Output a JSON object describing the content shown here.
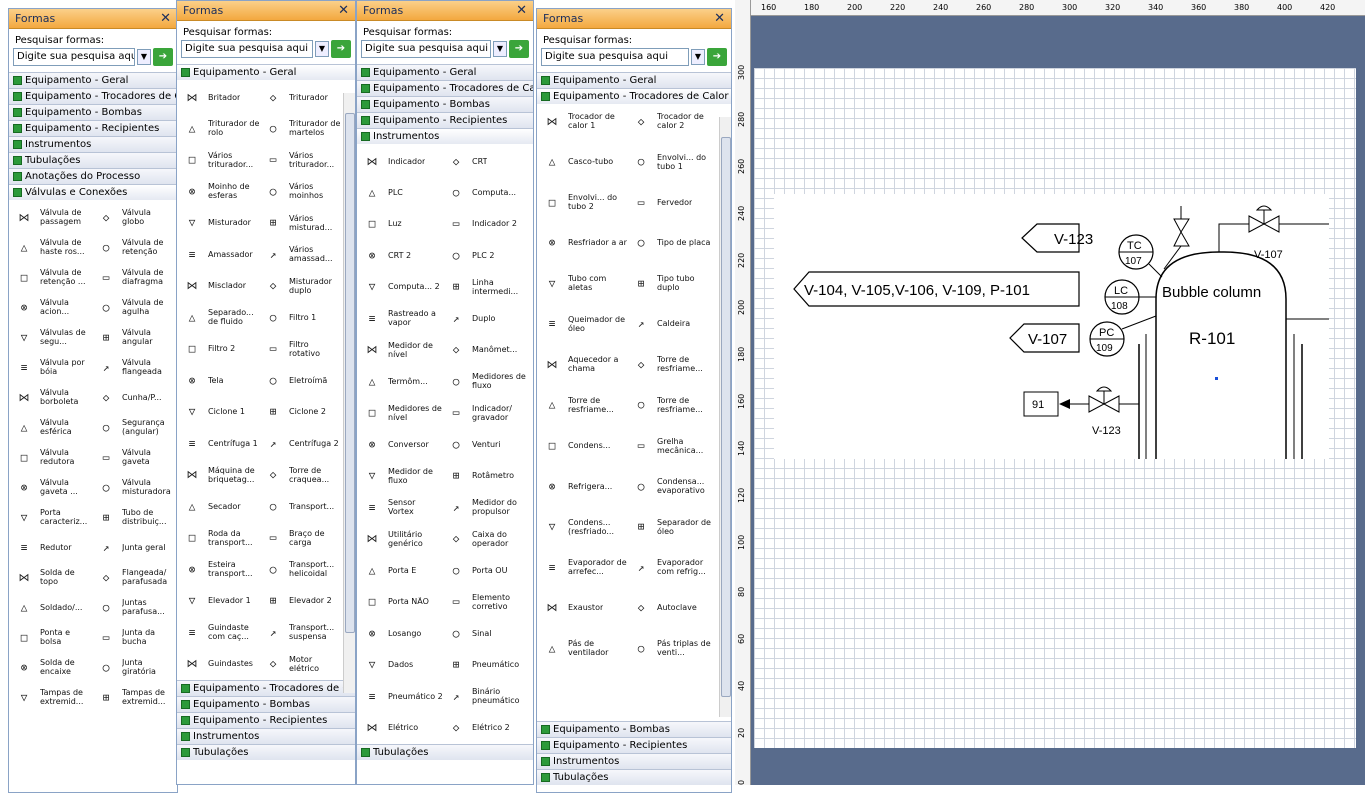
{
  "panel1": {
    "title": "Formas",
    "search_label": "Pesquisar formas:",
    "search_placeholder": "Digite sua pesquisa aqui",
    "categories_top": [
      "Equipamento - Geral",
      "Equipamento - Trocadores de Calor",
      "Equipamento - Bombas",
      "Equipamento - Recipientes",
      "Instrumentos",
      "Tubulações",
      "Anotações do Processo",
      "Válvulas e Conexões"
    ],
    "shapes": [
      "Válvula de passagem",
      "Válvula globo",
      "Válvula de haste ros...",
      "Válvula de retenção",
      "Válvula de retenção ...",
      "Válvula de diafragma",
      "Válvula acion...",
      "Válvula de agulha",
      "Válvulas de segu...",
      "Válvula angular",
      "Válvula por bóia",
      "Válvula flangeada",
      "Válvula borboleta",
      "Cunha/P...",
      "Válvula esférica",
      "Segurança (angular)",
      "Válvula redutora",
      "Válvula gaveta",
      "Válvula gaveta ...",
      "Válvula misturadora",
      "Porta caracteriz...",
      "Tubo de distribuiç...",
      "Redutor",
      "Junta geral",
      "Solda de topo",
      "Flangeada/ parafusada",
      "Soldado/...",
      "Juntas parafusa...",
      "Ponta e bolsa",
      "Junta da bucha",
      "Solda de encaixe",
      "Junta giratória",
      "Tampas de extremid...",
      "Tampas de extremid..."
    ]
  },
  "panel2": {
    "title": "Formas",
    "search_label": "Pesquisar formas:",
    "search_placeholder": "Digite sua pesquisa aqui",
    "categories_top": [
      "Equipamento - Geral"
    ],
    "shapes": [
      "Britador",
      "Triturador",
      "Triturador de rolo",
      "Triturador de martelos",
      "Vários triturador...",
      "Vários triturador...",
      "Moinho de esferas",
      "Vários moinhos",
      "Misturador",
      "Vários misturad...",
      "Amassador",
      "Vários amassad...",
      "Misclador",
      "Misturador duplo",
      "Separado... de fluido",
      "Filtro 1",
      "Filtro 2",
      "Filtro rotativo",
      "Tela",
      "Eletroímã",
      "Ciclone 1",
      "Ciclone 2",
      "Centrífuga 1",
      "Centrífuga 2",
      "Máquina de briquetag...",
      "Torre de craquea...",
      "Secador",
      "Transport...",
      "Roda da transport...",
      "Braço de carga",
      "Esteira transport...",
      "Transport... helicoidal",
      "Elevador 1",
      "Elevador 2",
      "Guindaste com caç...",
      "Transport... suspensa",
      "Guindastes",
      "Motor elétrico"
    ],
    "categories_bottom": [
      "Equipamento - Trocadores de Calor",
      "Equipamento - Bombas",
      "Equipamento - Recipientes",
      "Instrumentos",
      "Tubulações"
    ]
  },
  "panel3": {
    "title": "Formas",
    "search_label": "Pesquisar formas:",
    "search_placeholder": "Digite sua pesquisa aqui",
    "categories_top": [
      "Equipamento - Geral",
      "Equipamento - Trocadores de Calor",
      "Equipamento - Bombas",
      "Equipamento - Recipientes",
      "Instrumentos"
    ],
    "shapes": [
      "Indicador",
      "CRT",
      "PLC",
      "Computa...",
      "Luz",
      "Indicador 2",
      "CRT 2",
      "PLC 2",
      "Computa... 2",
      "Linha intermedi...",
      "Rastreado a vapor",
      "Duplo",
      "Medidor de nível",
      "Manômet...",
      "Termôm...",
      "Medidores de fluxo",
      "Medidores de nível",
      "Indicador/ gravador",
      "Conversor",
      "Venturi",
      "Medidor de fluxo",
      "Rotâmetro",
      "Sensor Vortex",
      "Medidor do propulsor",
      "Utilitário genérico",
      "Caixa do operador",
      "Porta E",
      "Porta OU",
      "Porta NÃO",
      "Elemento corretivo",
      "Losango",
      "Sinal",
      "Dados",
      "Pneumático",
      "Pneumático 2",
      "Binário pneumático",
      "Elétrico",
      "Elétrico 2"
    ],
    "categories_bottom": [
      "Tubulações"
    ]
  },
  "panel4": {
    "title": "Formas",
    "search_label": "Pesquisar formas:",
    "search_placeholder": "Digite sua pesquisa aqui",
    "categories_top": [
      "Equipamento - Geral",
      "Equipamento - Trocadores de Calor"
    ],
    "shapes": [
      "Trocador de calor 1",
      "Trocador de calor 2",
      "Casco-tubo",
      "Envolvi... do tubo 1",
      "Envolvi... do tubo 2",
      "Fervedor",
      "Resfriador a ar",
      "Tipo de placa",
      "Tubo com aletas",
      "Tipo tubo duplo",
      "Queimador de óleo",
      "Caldeira",
      "Aquecedor a chama",
      "Torre de resfriame...",
      "Torre de resfriame...",
      "Torre de resfriame...",
      "Condens...",
      "Grelha mecânica...",
      "Refrigera...",
      "Condensa... evaporativo",
      "Condens... (resfriado...",
      "Separador de óleo",
      "Evaporador de arrefec...",
      "Evaporador com refrig...",
      "Exaustor",
      "Autoclave",
      "Pás de ventilador",
      "Pás triplas de venti..."
    ],
    "categories_bottom": [
      "Equipamento - Bombas",
      "Equipamento - Recipientes",
      "Instrumentos",
      "Tubulações"
    ]
  },
  "ruler": {
    "top": [
      "160",
      "180",
      "200",
      "220",
      "240",
      "260",
      "280",
      "300",
      "320",
      "340",
      "360",
      "380",
      "400",
      "420"
    ],
    "left": [
      "300",
      "280",
      "260",
      "240",
      "220",
      "200",
      "180",
      "160",
      "140",
      "120",
      "100",
      "80",
      "60",
      "40",
      "20",
      "0"
    ]
  },
  "diagram": {
    "tag_v123_top": "V-123",
    "tag_long": "V-104, V-105,V-106, V-109, P-101",
    "tag_v107_left": "V-107",
    "tc": [
      "TC",
      "107"
    ],
    "lc": [
      "LC",
      "108"
    ],
    "pc": [
      "PC",
      "109"
    ],
    "column_title": "Bubble column",
    "column_id": "R-101",
    "valve_right": "V-107",
    "valve_bottom": "V-123",
    "box_91": "91"
  }
}
